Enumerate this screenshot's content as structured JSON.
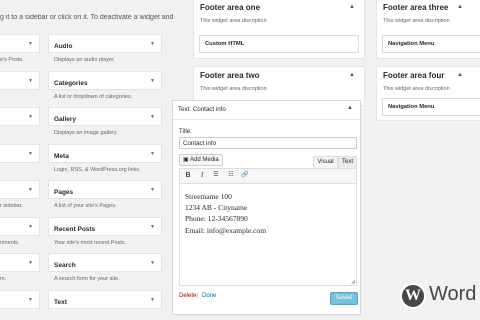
{
  "intro_text": "g it to a sidebar or click on it. To deactivate a widget and delete",
  "available_widgets": [
    {
      "col1_desc": "e's Posts.",
      "col2_title": "Audio",
      "col2_desc": "Displays an audio player."
    },
    {
      "col1_desc": "",
      "col2_title": "Categories",
      "col2_desc": "A list or dropdown of categories."
    },
    {
      "col1_desc": "",
      "col2_title": "Gallery",
      "col2_desc": "Displays an image gallery."
    },
    {
      "col1_desc": "",
      "col2_title": "Meta",
      "col2_desc": "Login, RSS, & WordPress.org links."
    },
    {
      "col1_desc": "r sidebar.",
      "col2_title": "Pages",
      "col2_desc": "A list of your site's Pages."
    },
    {
      "col1_desc": "nments.",
      "col2_title": "Recent Posts",
      "col2_desc": "Your site's most recent Posts."
    },
    {
      "col1_desc": "m.",
      "col2_title": "Search",
      "col2_desc": "A search form for your site."
    },
    {
      "col1_desc": "",
      "col2_title": "Text",
      "col2_desc": ""
    }
  ],
  "footer_areas": {
    "one": {
      "title": "Footer area one",
      "desc": "This widget area discription",
      "widget": "Custom HTML"
    },
    "two": {
      "title": "Footer area two",
      "desc": "This widget area discription"
    },
    "three": {
      "title": "Footer area three",
      "desc": "This widget area discription",
      "widget": "Navigation Menu"
    },
    "four": {
      "title": "Footer area four",
      "desc": "This widget area discription",
      "widget": "Navigation Menu"
    }
  },
  "text_widget": {
    "header": "Text: Contact info",
    "title_label": "Title:",
    "title_value": "Contact info",
    "add_media": "Add Media",
    "tab_visual": "Visual",
    "tab_text": "Text",
    "toolbar": {
      "bold": "B",
      "italic": "I",
      "bullets": "☰",
      "numbers": "☷",
      "link": "🔗"
    },
    "content_lines": [
      "Streetname 100",
      "1234 AB - Cityname",
      "Phone: 12-34567890",
      "Email: info@example.com"
    ],
    "delete": "Delete",
    "separator": "|",
    "done": "Done",
    "saved": "Saved"
  },
  "logo": {
    "text": "Word",
    "glyph": "W",
    "colors": {
      "badge": "#464646"
    }
  }
}
